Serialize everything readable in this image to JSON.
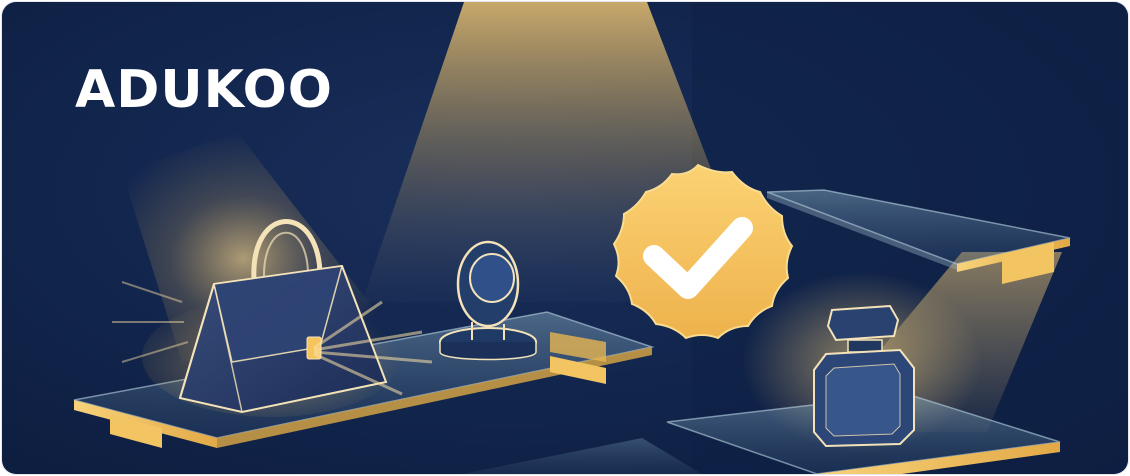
{
  "brand": {
    "name": "ADUKOO"
  },
  "illustration": {
    "icons": [
      "handbag-icon",
      "wristwatch-icon",
      "verified-badge-icon",
      "checkmark-icon",
      "perfume-bottle-icon"
    ]
  },
  "colors": {
    "background_navy": "#12264e",
    "spotlight_gold": "#f3c969",
    "badge_gold": "#f6c45c",
    "shelf_edge_gold": "#f2c462",
    "outline_cream": "#f4e3b8"
  }
}
